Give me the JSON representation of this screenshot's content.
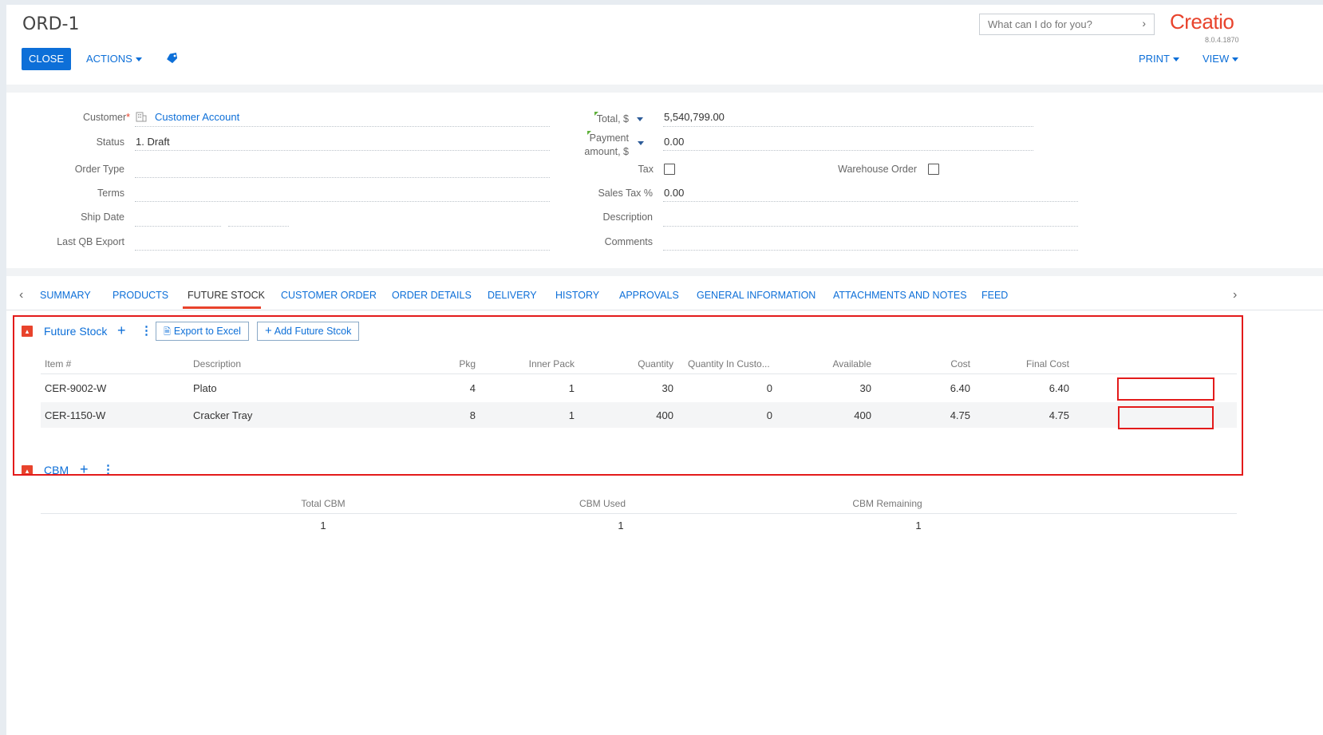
{
  "header": {
    "title": "ORD-1",
    "close_label": "CLOSE",
    "actions_label": "ACTIONS",
    "print_label": "PRINT",
    "view_label": "VIEW",
    "search_placeholder": "What can I do for you?",
    "logo_text": "Creatio",
    "version": "8.0.4.1870"
  },
  "form": {
    "left": {
      "customer_label": "Customer",
      "customer_required": "*",
      "customer_value": "Customer Account",
      "status_label": "Status",
      "status_value": "1. Draft",
      "order_type_label": "Order Type",
      "terms_label": "Terms",
      "ship_date_label": "Ship Date",
      "last_qb_label": "Last QB Export"
    },
    "right": {
      "total_label": "Total, $",
      "total_value": "5,540,799.00",
      "payment_label_1": "Payment",
      "payment_label_2": "amount, $",
      "payment_value": "0.00",
      "tax_label": "Tax",
      "tax_checked": false,
      "warehouse_label": "Warehouse Order",
      "warehouse_checked": false,
      "sales_tax_label": "Sales Tax %",
      "sales_tax_value": "0.00",
      "description_label": "Description",
      "comments_label": "Comments"
    }
  },
  "tabs": [
    {
      "label": "SUMMARY",
      "active": false
    },
    {
      "label": "PRODUCTS",
      "active": false
    },
    {
      "label": "FUTURE STOCK",
      "active": true
    },
    {
      "label": "CUSTOMER ORDER",
      "active": false
    },
    {
      "label": "ORDER DETAILS",
      "active": false
    },
    {
      "label": "DELIVERY",
      "active": false
    },
    {
      "label": "HISTORY",
      "active": false
    },
    {
      "label": "APPROVALS",
      "active": false
    },
    {
      "label": "GENERAL INFORMATION",
      "active": false
    },
    {
      "label": "ATTACHMENTS AND NOTES",
      "active": false
    },
    {
      "label": "FEED",
      "active": false
    }
  ],
  "future_stock": {
    "title": "Future Stock",
    "export_label": "Export to Excel",
    "add_label": "Add Future Stcok",
    "columns": [
      "Item #",
      "Description",
      "Pkg",
      "Inner Pack",
      "Quantity",
      "Quantity In Custo...",
      "Available",
      "Cost",
      "Final Cost"
    ],
    "rows": [
      [
        "CER-9002-W",
        "Plato",
        "4",
        "1",
        "30",
        "0",
        "30",
        "6.40",
        "6.40"
      ],
      [
        "CER-1150-W",
        "Cracker Tray",
        "8",
        "1",
        "400",
        "0",
        "400",
        "4.75",
        "4.75"
      ]
    ]
  },
  "cbm": {
    "title": "CBM",
    "columns": [
      "Total CBM",
      "CBM Used",
      "CBM Remaining"
    ],
    "row": [
      "1",
      "1",
      "1"
    ]
  },
  "colors": {
    "accent": "#0d6fd8",
    "brand": "#e8432c",
    "highlight": "#e31b1b"
  }
}
